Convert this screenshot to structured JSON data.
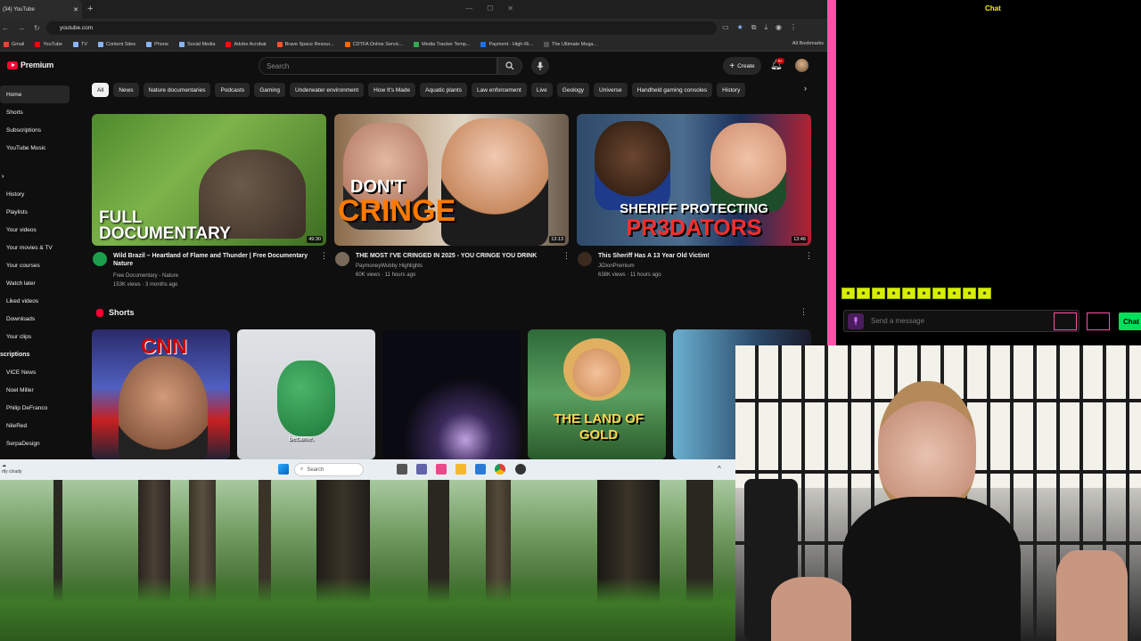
{
  "browser": {
    "tab_title": "(34) YouTube",
    "url": "youtube.com",
    "bookmarks": [
      "Gmail",
      "YouTube",
      "TV",
      "Content Sites",
      "Phone",
      "Social Media",
      "Adobe Acrobat",
      "Brave Space Resour...",
      "CDTFA Online Servic...",
      "Media Tracker Temp...",
      "Payment - High-Ri...",
      "The Ultimate Mega..."
    ],
    "all_bookmarks": "All Bookmarks"
  },
  "youtube": {
    "logo_text": "Premium",
    "search_placeholder": "Search",
    "create_label": "Create",
    "notif_badge": "9+",
    "sidebar": {
      "main": [
        "Home",
        "Shorts",
        "Subscriptions",
        "YouTube Music"
      ],
      "you": [
        "History",
        "Playlists",
        "Your videos",
        "Your movies & TV",
        "Your courses",
        "Watch later",
        "Liked videos",
        "Downloads",
        "Your clips"
      ],
      "subscriptions_header": "scriptions",
      "subs": [
        "VICE News",
        "Noel Miller",
        "Philip DeFranco",
        "NileRed",
        "SerpaDesign"
      ]
    },
    "chips": [
      "All",
      "News",
      "Nature documentaries",
      "Podcasts",
      "Gaming",
      "Underwater environment",
      "How It's Made",
      "Aquatic plants",
      "Law enforcement",
      "Live",
      "Geology",
      "Universe",
      "Handheld gaming consoles",
      "History"
    ],
    "videos": [
      {
        "title": "Wild Brazil – Heartland of Flame and Thunder | Free Documentary Nature",
        "channel": "Free Documentary - Nature",
        "meta": "153K views · 3 months ago",
        "duration": "49:30",
        "overlay_line1": "FULL",
        "overlay_line2": "DOCUMENTARY"
      },
      {
        "title": "THE MOST I'VE CRINGED IN 2025 - YOU CRINGE YOU DRINK",
        "channel": "PaymoneyWubby Highlights",
        "meta": "60K views · 11 hours ago",
        "duration": "13:13",
        "overlay_line1": "DON'T",
        "overlay_line2": "CRINGE"
      },
      {
        "title": "This Sheriff Has A 13 Year Old Victim!",
        "channel": "JiDionPremium",
        "meta": "638K views · 11 hours ago",
        "duration": "13:46",
        "overlay_line1": "SHERIFF PROTECTING",
        "overlay_line2": "PR3DATORS"
      }
    ],
    "shorts_header": "Shorts",
    "shorts": [
      {
        "caption": "CNN"
      },
      {
        "caption": "became."
      },
      {
        "caption": ""
      },
      {
        "caption": "THE LAND OF GOLD"
      },
      {
        "caption": ""
      }
    ]
  },
  "taskbar": {
    "search_placeholder": "Search",
    "weather": "rtly cloudy"
  },
  "chat": {
    "title": "Chat",
    "message_placeholder": "Send a message",
    "send_label": "Chat",
    "accent": "#ff4fa8",
    "send_color": "#00e05a"
  }
}
